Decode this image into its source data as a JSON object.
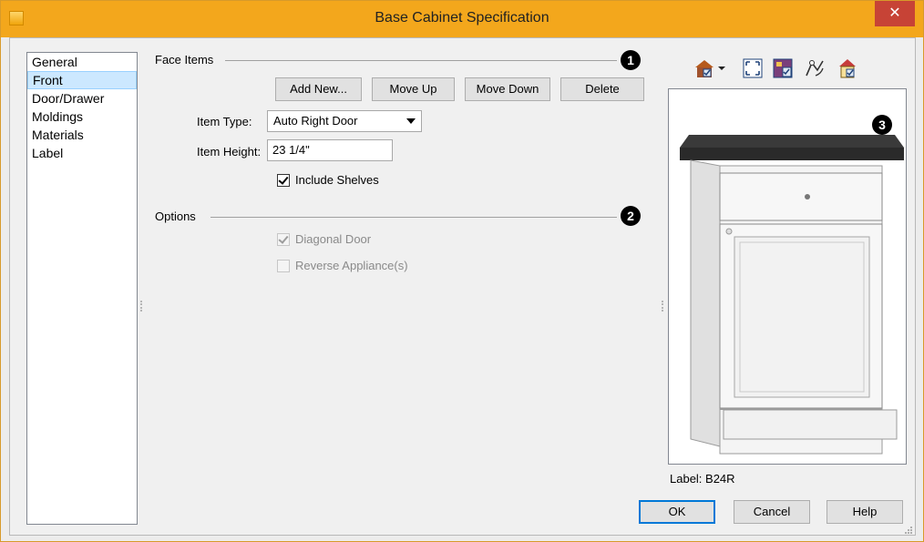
{
  "window": {
    "title": "Base Cabinet Specification",
    "close_glyph": "✕"
  },
  "nav": {
    "items": [
      {
        "label": "General",
        "selected": false
      },
      {
        "label": "Front",
        "selected": true
      },
      {
        "label": "Door/Drawer",
        "selected": false
      },
      {
        "label": "Moldings",
        "selected": false
      },
      {
        "label": "Materials",
        "selected": false
      },
      {
        "label": "Label",
        "selected": false
      }
    ]
  },
  "face_items": {
    "heading": "Face Items",
    "marker": "1",
    "buttons": {
      "add_new": "Add New...",
      "move_up": "Move Up",
      "move_down": "Move Down",
      "delete": "Delete"
    },
    "item_type_label": "Item Type:",
    "item_type_value": "Auto Right Door",
    "item_height_label": "Item Height:",
    "item_height_value": "23 1/4\"",
    "include_shelves_label": "Include Shelves",
    "include_shelves_checked": true
  },
  "options": {
    "heading": "Options",
    "marker": "2",
    "diagonal_door_label": "Diagonal Door",
    "diagonal_door_checked": true,
    "reverse_appliance_label": "Reverse Appliance(s)",
    "reverse_appliance_checked": false
  },
  "preview": {
    "marker": "3",
    "label_text": "Label:  B24R"
  },
  "toolbar": {
    "icons": [
      "view-3d-dropdown-icon",
      "fit-view-icon",
      "show-materials-icon",
      "orbit-icon",
      "show-options-icon"
    ]
  },
  "footer": {
    "ok": "OK",
    "cancel": "Cancel",
    "help": "Help"
  },
  "colors": {
    "titlebar": "#f3a71c",
    "close": "#c74336",
    "selection": "#cce8ff",
    "countertop": "#3a3a3a",
    "cabinet_body": "#f2f2f2"
  }
}
